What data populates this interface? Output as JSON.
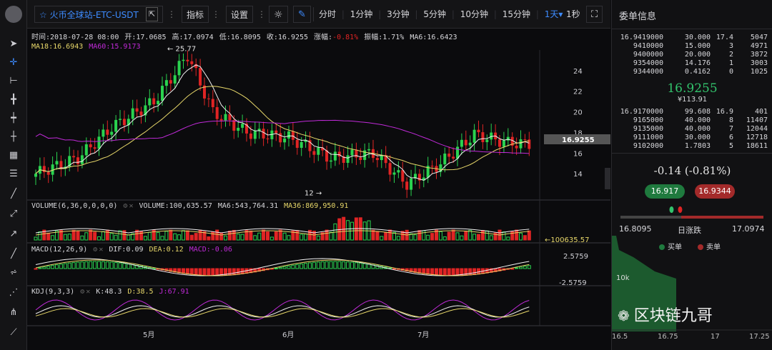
{
  "toolbar": {
    "symbol": "火币全球站-ETC-USDT",
    "indicators_label": "指标",
    "settings_label": "设置",
    "periods": [
      "分时",
      "1分钟",
      "3分钟",
      "5分钟",
      "10分钟",
      "15分钟",
      "1天▾"
    ],
    "active_period": "1天▾",
    "refresh_label": "1秒"
  },
  "legend_main": {
    "time": "时间:2018-07-28 08:00",
    "open": "开:17.0685",
    "high": "高:17.0974",
    "low": "低:16.8095",
    "close": "收:16.9255",
    "change_label": "涨幅:",
    "change_value": "-0.81%",
    "amplitude": "振幅:1.71%",
    "ma6": "MA6:16.6423",
    "ma18": "MA18:16.6943",
    "ma60": "MA60:15.9173"
  },
  "legend_volume": {
    "title": "VOLUME(6,36,0,0,0,0)",
    "volume": "VOLUME:100,635.57",
    "ma6": "MA6:543,764.31",
    "ma36": "MA36:869,950.91"
  },
  "legend_macd": {
    "title": "MACD(12,26,9)",
    "dif": "DIF:0.09",
    "dea": "DEA:0.12",
    "macd": "MACD:-0.06"
  },
  "legend_kdj": {
    "title": "KDJ(9,3,3)",
    "k": "K:48.3",
    "d": "D:38.5",
    "j": "J:67.91"
  },
  "chart_labels": {
    "high_marker": "← 25.77",
    "low_marker": "12 →",
    "price_tag": "16.9255",
    "volume_tag": "←100635.57",
    "macd_top": "2.5759",
    "macd_bottom": "-2.5759",
    "y_ticks": [
      "24",
      "22",
      "20",
      "18",
      "16",
      "14"
    ],
    "x_ticks": [
      "5月",
      "6月",
      "7月"
    ]
  },
  "colors": {
    "up": "#2ad34f",
    "down": "#e02424",
    "ma6": "#f2f2f2",
    "ma18": "#e8d86a",
    "ma60": "#c02ad8",
    "accent": "#3d8bff"
  },
  "orderbook": {
    "title": "委单信息",
    "asks": [
      {
        "price": "16.9419000",
        "qty": "30.000",
        "total": "17.4",
        "count": "5047"
      },
      {
        "price": "9410000",
        "qty": "15.000",
        "total": "3",
        "count": "4971"
      },
      {
        "price": "9400000",
        "qty": "20.000",
        "total": "2",
        "count": "3872"
      },
      {
        "price": "9354000",
        "qty": "14.176",
        "total": "1",
        "count": "3003"
      },
      {
        "price": "9344000",
        "qty": "0.4162",
        "total": "0",
        "count": "1025"
      }
    ],
    "last_price": "16.9255",
    "last_cny": "¥113.91",
    "bids": [
      {
        "price": "16.9170000",
        "qty": "99.608",
        "total": "16.9",
        "count": "401"
      },
      {
        "price": "9165000",
        "qty": "40.000",
        "total": "8",
        "count": "11407"
      },
      {
        "price": "9135000",
        "qty": "40.000",
        "total": "7",
        "count": "12044"
      },
      {
        "price": "9111000",
        "qty": "30.000",
        "total": "6",
        "count": "12718"
      },
      {
        "price": "9102000",
        "qty": "1.7803",
        "total": "5",
        "count": "18611"
      }
    ],
    "change": "-0.14 (-0.81%)",
    "buy_price": "16.917",
    "sell_price": "16.9344",
    "range_low": "16.8095",
    "range_label": "日涨跌",
    "range_high": "17.0974",
    "legend_buy": "买单",
    "legend_sell": "卖单",
    "depth_y": "10k",
    "depth_x": [
      "16.5",
      "16.75",
      "17",
      "17.25"
    ]
  },
  "watermark": "区块链九哥"
}
